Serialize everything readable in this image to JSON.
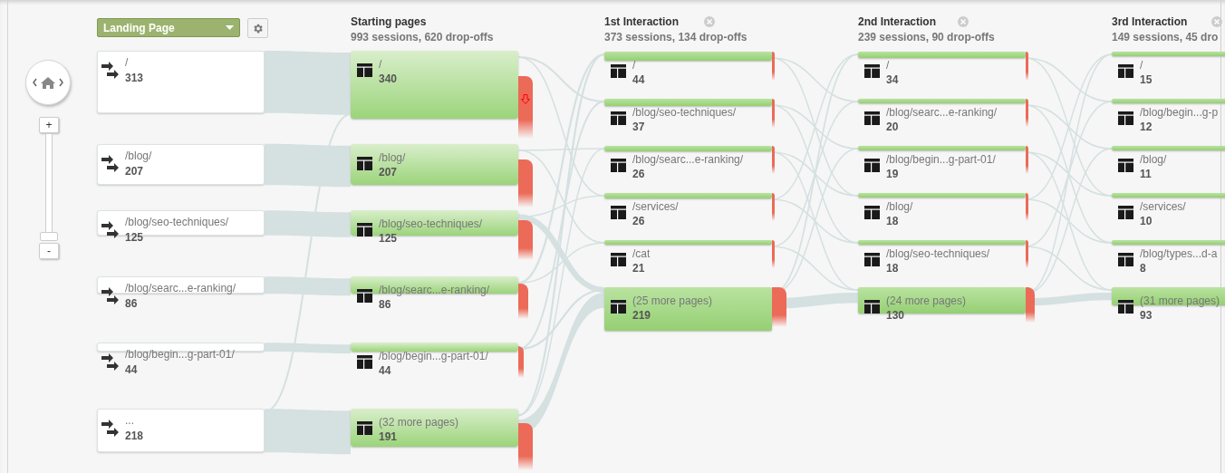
{
  "nav": {
    "zoom_in": "+",
    "zoom_out": "-",
    "zoom": {
      "level": 0
    }
  },
  "landing": {
    "dimension": "Landing Page",
    "nodes": [
      {
        "page": "/",
        "sessions": "313"
      },
      {
        "page": "/blog/",
        "sessions": "207"
      },
      {
        "page": "/blog/seo-techniques/",
        "sessions": "125"
      },
      {
        "page": "/blog/searc...e-ranking/",
        "sessions": "86"
      },
      {
        "page": "/blog/begin...g-part-01/",
        "sessions": "44"
      },
      {
        "page": "...",
        "sessions": "218"
      }
    ]
  },
  "steps": [
    {
      "title": "Starting pages",
      "summary": "993 sessions, 620 drop-offs",
      "closable": false,
      "nodes": [
        {
          "page": "/",
          "sessions": "340",
          "dropoff_arrow": true
        },
        {
          "page": "/blog/",
          "sessions": "207",
          "dropoff_arrow": false
        },
        {
          "page": "/blog/seo-techniques/",
          "sessions": "125",
          "dropoff_arrow": false
        },
        {
          "page": "/blog/searc...e-ranking/",
          "sessions": "86",
          "dropoff_arrow": false
        },
        {
          "page": "/blog/begin...g-part-01/",
          "sessions": "44",
          "dropoff_arrow": false
        },
        {
          "page": "(32 more pages)",
          "sessions": "191",
          "dropoff_arrow": false
        }
      ]
    },
    {
      "title": "1st Interaction",
      "summary": "373 sessions, 134 drop-offs",
      "closable": true,
      "nodes": [
        {
          "page": "/",
          "sessions": "44",
          "dropoff_arrow": false
        },
        {
          "page": "/blog/seo-techniques/",
          "sessions": "37",
          "dropoff_arrow": false
        },
        {
          "page": "/blog/searc...e-ranking/",
          "sessions": "26",
          "dropoff_arrow": false
        },
        {
          "page": "/services/",
          "sessions": "26",
          "dropoff_arrow": false
        },
        {
          "page": "/cat",
          "sessions": "21",
          "dropoff_arrow": false
        },
        {
          "page": "(25 more pages)",
          "sessions": "219",
          "dropoff_arrow": false
        }
      ]
    },
    {
      "title": "2nd Interaction",
      "summary": "239 sessions, 90 drop-offs",
      "closable": true,
      "nodes": [
        {
          "page": "/",
          "sessions": "34",
          "dropoff_arrow": false
        },
        {
          "page": "/blog/searc...e-ranking/",
          "sessions": "20",
          "dropoff_arrow": false
        },
        {
          "page": "/blog/begin...g-part-01/",
          "sessions": "19",
          "dropoff_arrow": false
        },
        {
          "page": "/blog/",
          "sessions": "18",
          "dropoff_arrow": false
        },
        {
          "page": "/blog/seo-techniques/",
          "sessions": "18",
          "dropoff_arrow": false
        },
        {
          "page": "(24 more pages)",
          "sessions": "130",
          "dropoff_arrow": false
        }
      ]
    },
    {
      "title": "3rd Interaction",
      "summary": "149 sessions, 45 dro",
      "closable": true,
      "nodes": [
        {
          "page": "/",
          "sessions": "15",
          "dropoff_arrow": false
        },
        {
          "page": "/blog/begin...g-p",
          "sessions": "12",
          "dropoff_arrow": false
        },
        {
          "page": "/blog/",
          "sessions": "11",
          "dropoff_arrow": false
        },
        {
          "page": "/services/",
          "sessions": "10",
          "dropoff_arrow": false
        },
        {
          "page": "/blog/types...d-a",
          "sessions": "8",
          "dropoff_arrow": false
        },
        {
          "page": "(31 more pages)",
          "sessions": "93",
          "dropoff_arrow": false
        }
      ]
    }
  ]
}
